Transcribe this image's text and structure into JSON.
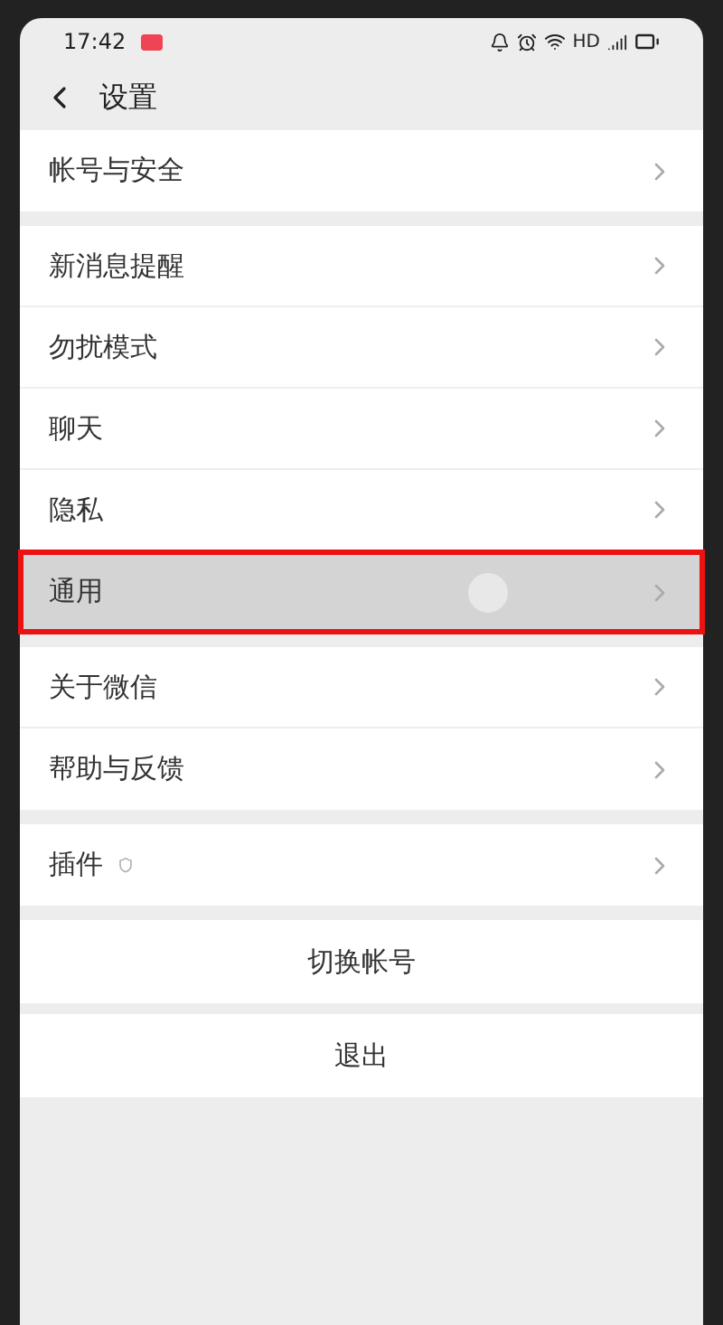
{
  "status_bar": {
    "time": "17:42",
    "network": "HD"
  },
  "header": {
    "title": "设置"
  },
  "sections": [
    {
      "items": [
        {
          "label": "帐号与安全",
          "selected": false
        }
      ]
    },
    {
      "items": [
        {
          "label": "新消息提醒",
          "selected": false
        },
        {
          "label": "勿扰模式",
          "selected": false
        },
        {
          "label": "聊天",
          "selected": false
        },
        {
          "label": "隐私",
          "selected": false
        },
        {
          "label": "通用",
          "selected": true
        }
      ]
    },
    {
      "items": [
        {
          "label": "关于微信",
          "selected": false
        },
        {
          "label": "帮助与反馈",
          "selected": false
        }
      ]
    },
    {
      "items": [
        {
          "label": "插件",
          "selected": false,
          "badge": true
        }
      ]
    }
  ],
  "actions": [
    "切换帐号",
    "退出"
  ]
}
